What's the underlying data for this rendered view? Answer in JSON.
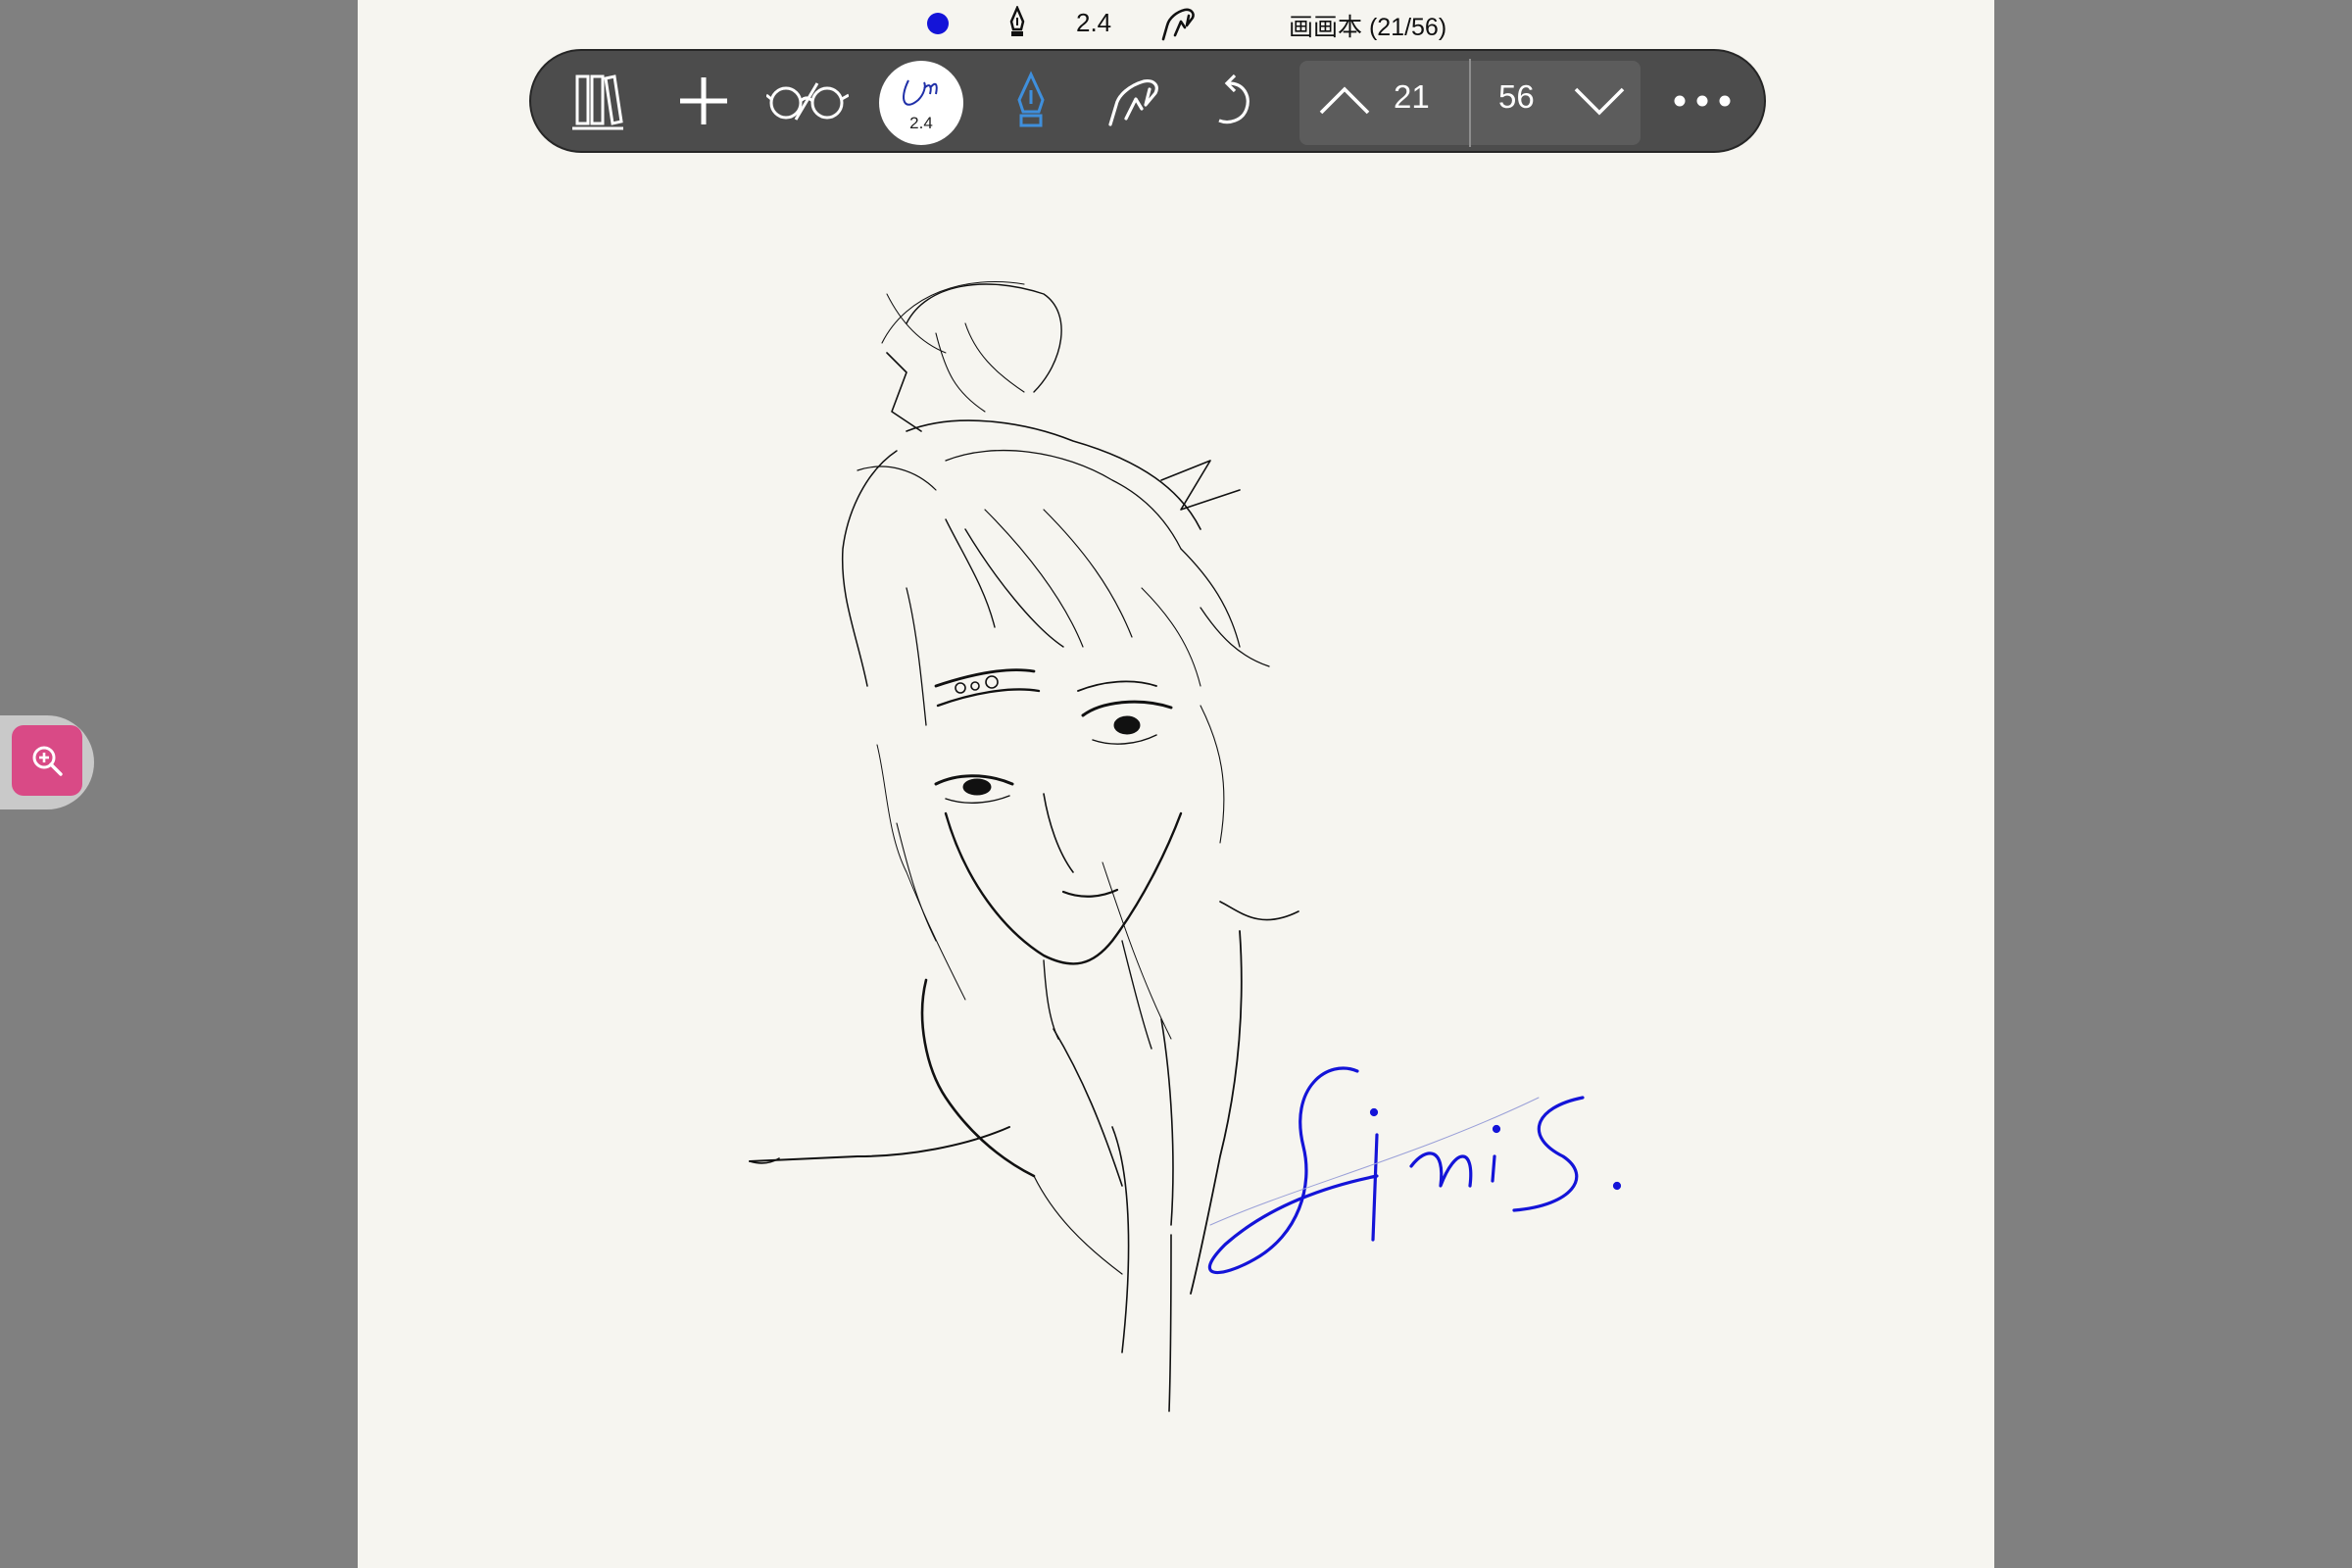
{
  "status_bar": {
    "pen_color": "#1414d8",
    "pen_icon": "fountain-pen-icon",
    "pen_width": "2.4",
    "hand_icon": "palm-rejection-hand-icon",
    "notebook_title": "画画本 (21/56)"
  },
  "toolbar": {
    "library_icon": "bookshelf-icon",
    "add_icon": "plus-icon",
    "view_icon": "reading-glasses-icon",
    "pen_preview_width": "2.4",
    "pen_tool_icon": "pen-nib-icon",
    "pen_tool_color": "#3f8fdc",
    "hand_tool_icon": "hand-draw-icon",
    "undo_icon": "undo-icon",
    "prev_page_icon": "chevron-up-icon",
    "current_page": "21",
    "total_pages": "56",
    "next_page_icon": "chevron-down-icon",
    "more_icon": "more-horizontal-icon"
  },
  "side_panel": {
    "zoom_icon": "zoom-in-icon",
    "accent": "#d94a86"
  },
  "canvas": {
    "background": "#f6f5f0",
    "ink_color": "#111111",
    "signature_color": "#1414d8",
    "signature_text": "Siris."
  }
}
